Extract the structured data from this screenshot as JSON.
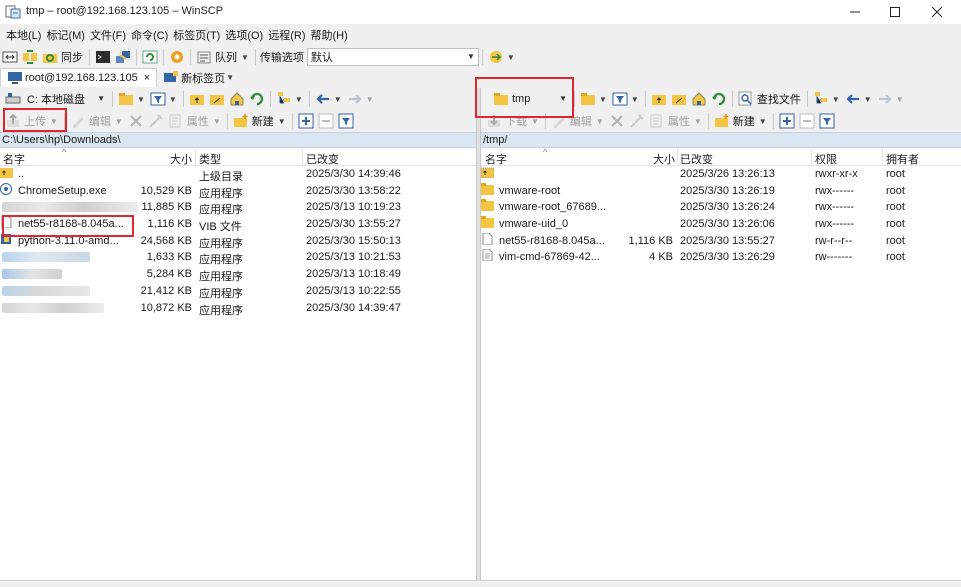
{
  "window": {
    "title": "tmp – root@192.168.123.105 – WinSCP"
  },
  "menu": [
    "本地(L)",
    "标记(M)",
    "文件(F)",
    "命令(C)",
    "标签页(T)",
    "选项(O)",
    "远程(R)",
    "帮助(H)"
  ],
  "toolbar": {
    "sync_label": "同步",
    "queue_label": "队列",
    "transfer_settings_label": "传输选项",
    "transfer_settings_value": "默认"
  },
  "tabs": [
    {
      "label": "root@192.168.123.105",
      "close": "×"
    },
    {
      "label": "新标签页"
    }
  ],
  "left_pane": {
    "drive": "C: 本地磁盘",
    "upload_label": "上传",
    "edit_label": "编辑",
    "properties_label": "属性",
    "new_label": "新建",
    "path": "C:\\Users\\hp\\Downloads\\",
    "columns": {
      "name": "名字",
      "size": "大小",
      "type": "类型",
      "changed": "已改变"
    },
    "rows": [
      {
        "name": "..",
        "size": "",
        "type": "上级目录",
        "changed": "2025/3/30 14:39:46",
        "icon": "parent-folder-icon"
      },
      {
        "name": "ChromeSetup.exe",
        "size": "10,529 KB",
        "type": "应用程序",
        "changed": "2025/3/30 13:58:22",
        "icon": "chrome-setup-icon"
      },
      {
        "name": "",
        "size": "11,885 KB",
        "type": "应用程序",
        "changed": "2025/3/13 10:19:23",
        "icon": "app-icon",
        "blurred": true
      },
      {
        "name": "net55-r8168-8.045a...",
        "size": "1,116 KB",
        "type": "VIB 文件",
        "changed": "2025/3/30 13:55:27",
        "icon": "file-icon"
      },
      {
        "name": "python-3.11.0-amd...",
        "size": "24,568 KB",
        "type": "应用程序",
        "changed": "2025/3/30 15:50:13",
        "icon": "python-installer-icon"
      },
      {
        "name": "",
        "size": "1,633 KB",
        "type": "应用程序",
        "changed": "2025/3/13 10:21:53",
        "icon": "app-icon",
        "blurred": true
      },
      {
        "name": "",
        "size": "5,284 KB",
        "type": "应用程序",
        "changed": "2025/3/13 10:18:49",
        "icon": "app-icon",
        "blurred": true
      },
      {
        "name": "",
        "size": "21,412 KB",
        "type": "应用程序",
        "changed": "2025/3/13 10:22:55",
        "icon": "app-icon",
        "blurred": true
      },
      {
        "name": "",
        "size": "10,872 KB",
        "type": "应用程序",
        "changed": "2025/3/30 14:39:47",
        "icon": "app-icon",
        "blurred": true
      }
    ]
  },
  "right_pane": {
    "folder": "tmp",
    "download_label": "下载",
    "edit_label": "编辑",
    "properties_label": "属性",
    "new_label": "新建",
    "find_label": "查找文件",
    "path": "/tmp/",
    "columns": {
      "name": "名字",
      "size": "大小",
      "changed": "已改变",
      "rights": "权限",
      "owner": "拥有者"
    },
    "rows": [
      {
        "name": "..",
        "size": "",
        "changed": "2025/3/26 13:26:13",
        "rights": "rwxr-xr-x",
        "owner": "root",
        "icon": "parent-folder-icon"
      },
      {
        "name": "vmware-root",
        "size": "",
        "changed": "2025/3/30 13:26:19",
        "rights": "rwx------",
        "owner": "root",
        "icon": "folder-icon"
      },
      {
        "name": "vmware-root_67689...",
        "size": "",
        "changed": "2025/3/30 13:26:24",
        "rights": "rwx------",
        "owner": "root",
        "icon": "folder-icon"
      },
      {
        "name": "vmware-uid_0",
        "size": "",
        "changed": "2025/3/30 13:26:06",
        "rights": "rwx------",
        "owner": "root",
        "icon": "folder-icon"
      },
      {
        "name": "net55-r8168-8.045a...",
        "size": "1,116 KB",
        "changed": "2025/3/30 13:55:27",
        "rights": "rw-r--r--",
        "owner": "root",
        "icon": "file-icon"
      },
      {
        "name": "vim-cmd-67869-42...",
        "size": "4 KB",
        "changed": "2025/3/30 13:26:29",
        "rights": "rw-------",
        "owner": "root",
        "icon": "text-file-icon"
      }
    ]
  },
  "colors": {
    "highlight": "#e0252f",
    "path_bar": "#dbe6f3",
    "folder": "#f4c542"
  }
}
